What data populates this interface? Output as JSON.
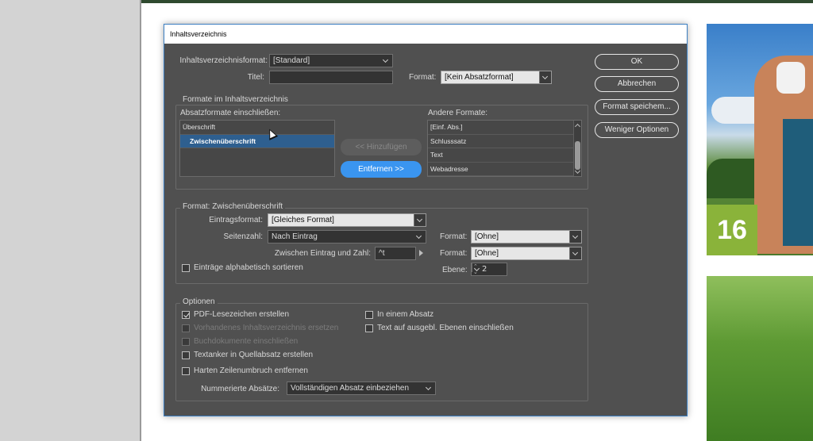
{
  "dialog": {
    "title": "Inhaltsverzeichnis"
  },
  "top": {
    "format_label": "Inhaltsverzeichnisformat:",
    "format_value": "[Standard]",
    "title_label": "Titel:",
    "title_value": "",
    "absatz_format_label": "Format:",
    "absatz_format_value": "[Kein Absatzformat]"
  },
  "buttons": {
    "ok": "OK",
    "cancel": "Abbrechen",
    "save_format": "Format speichem...",
    "fewer_options": "Weniger Optionen"
  },
  "formats_group": {
    "title": "Formate im Inhaltsverzeichnis",
    "include_label": "Absatzformate einschließen:",
    "included": [
      "Überschrift",
      "Zwischenüberschrift"
    ],
    "selected_index": 1,
    "add_button": "<< Hinzufügen",
    "remove_button": "Entfernen >>",
    "other_label": "Andere Formate:",
    "other": [
      "[Einf. Abs.]",
      "Schlusssatz",
      "Text",
      "Webadresse"
    ]
  },
  "style_group": {
    "title": "Format: Zwischenüberschrift",
    "entry_format_label": "Eintragsformat:",
    "entry_format_value": "[Gleiches Format]",
    "page_number_label": "Seitenzahl:",
    "page_number_value": "Nach Eintrag",
    "page_number_format_label": "Format:",
    "page_number_format_value": "[Ohne]",
    "between_label": "Zwischen Eintrag und Zahl:",
    "between_value": "^t",
    "between_format_label": "Format:",
    "between_format_value": "[Ohne]",
    "sort_label": "Einträge alphabetisch sortieren",
    "sort_checked": false,
    "level_label": "Ebene:",
    "level_value": "2"
  },
  "options_group": {
    "title": "Optionen",
    "pdf_bookmarks": "PDF-Lesezeichen erstellen",
    "replace_existing": "Vorhandenes Inhaltsverzeichnis ersetzen",
    "book_documents": "Buchdokumente einschließen",
    "text_anchor": "Textanker in Quellabsatz erstellen",
    "remove_breaks": "Harten Zeilenumbruch entfernen",
    "one_paragraph": "In einem Absatz",
    "hidden_layers": "Text auf ausgebl. Ebenen einschließen",
    "numbered_label": "Nummerierte Absätze:",
    "numbered_value": "Vollständigen Absatz einbeziehen"
  },
  "page": {
    "badge_number": "16"
  }
}
